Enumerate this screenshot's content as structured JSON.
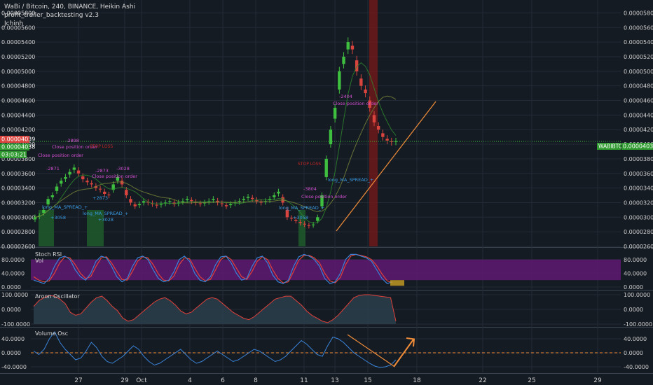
{
  "header": {
    "title": "WaBi / Bitcoin, 240, BINANCE, Heikin Ashi",
    "study": "profit_trailer_backtesting v2.3",
    "author": "Jchinh"
  },
  "price_badges": {
    "last_red": "0.00004039",
    "last_green": "0.00004038",
    "countdown": "03:03:21",
    "symbol_label": "WABIBTC",
    "symbol_value": "0.00004038"
  },
  "annotations": {
    "close_position": "Close position order",
    "long_spread": "long_MA_SPREAD_+",
    "stop_loss": "STOP LOSS",
    "labels": [
      "-2898",
      "-2871",
      "-2873",
      "-3028",
      "+2873",
      "+3028",
      "+3058",
      "-3804",
      "+3058",
      "-2404"
    ]
  },
  "colors": {
    "background": "#151b23",
    "grid": "#232b36",
    "candle_up": "#3fbf3f",
    "candle_down": "#d9443e",
    "purple_band": "#5a1a6e",
    "stoch_k": "#3a83d8",
    "stoch_d": "#e0413a",
    "aroon_fill": "#2a3d4a",
    "aroon_line": "#e0413a",
    "volosc_line": "#3a83d8",
    "trend_orange": "#f08d3a",
    "magenta_text": "#d050d0",
    "blue_text": "#3a9ae0"
  },
  "chart_data": [
    {
      "type": "candlestick",
      "title": "WaBi / Bitcoin, 240, BINANCE, Heikin Ashi",
      "y_ticks": [
        "0.00005800",
        "0.00005600",
        "0.00005400",
        "0.00005200",
        "0.00005000",
        "0.00004800",
        "0.00004600",
        "0.00004400",
        "0.00004200",
        "0.00004000",
        "0.00003800",
        "0.00003600",
        "0.00003400",
        "0.00003200",
        "0.00003000",
        "0.00002800",
        "0.00002600"
      ],
      "ylim": [
        2.6e-05,
        5.9e-05
      ],
      "x_ticks": [
        "27",
        "29",
        "Oct",
        "4",
        "6",
        "8",
        "11",
        "13",
        "15",
        "18",
        "22",
        "25",
        "29"
      ],
      "close": [
        3e-05,
        3.02e-05,
        3.1e-05,
        3.25e-05,
        3.3e-05,
        3.42e-05,
        3.5e-05,
        3.55e-05,
        3.62e-05,
        3.68e-05,
        3.6e-05,
        3.52e-05,
        3.48e-05,
        3.45e-05,
        3.4e-05,
        3.38e-05,
        3.32e-05,
        3.3e-05,
        3.45e-05,
        3.55e-05,
        3.45e-05,
        3.3e-05,
        3.2e-05,
        3.15e-05,
        3.18e-05,
        3.22e-05,
        3.2e-05,
        3.18e-05,
        3.16e-05,
        3.18e-05,
        3.2e-05,
        3.22e-05,
        3.18e-05,
        3.2e-05,
        3.22e-05,
        3.25e-05,
        3.22e-05,
        3.2e-05,
        3.18e-05,
        3.2e-05,
        3.22e-05,
        3.25e-05,
        3.2e-05,
        3.18e-05,
        3.15e-05,
        3.18e-05,
        3.2e-05,
        3.22e-05,
        3.25e-05,
        3.28e-05,
        3.25e-05,
        3.22e-05,
        3.2e-05,
        3.22e-05,
        3.25e-05,
        3.3e-05,
        3.35e-05,
        3.2e-05,
        3e-05,
        2.98e-05,
        2.95e-05,
        2.92e-05,
        2.9e-05,
        2.88e-05,
        2.9e-05,
        3e-05,
        3.3e-05,
        3.8e-05,
        4.2e-05,
        4.5e-05,
        5e-05,
        5.2e-05,
        5.4e-05,
        5.3e-05,
        5e-05,
        4.8e-05,
        4.7e-05,
        4.5e-05,
        4.3e-05,
        4.2e-05,
        4.1e-05,
        4.05e-05,
        4.03e-05,
        4.04e-05
      ]
    },
    {
      "type": "line",
      "title": "Stoch RSI",
      "legend": [
        "Vol"
      ],
      "y_ticks": [
        "80.0000",
        "40.0000",
        "0.0000"
      ],
      "ylim": [
        0,
        100
      ],
      "k": [
        20,
        15,
        10,
        25,
        60,
        85,
        90,
        80,
        50,
        30,
        20,
        40,
        75,
        90,
        85,
        60,
        30,
        15,
        25,
        60,
        85,
        90,
        80,
        50,
        25,
        15,
        20,
        45,
        80,
        90,
        75,
        40,
        20,
        15,
        30,
        65,
        88,
        90,
        70,
        40,
        20,
        25,
        60,
        85,
        90,
        70,
        35,
        15,
        10,
        20,
        60,
        88,
        95,
        90,
        80,
        60,
        25,
        10,
        15,
        40,
        80,
        95,
        95,
        90,
        85,
        75,
        50,
        25,
        10,
        15
      ],
      "d": [
        30,
        20,
        15,
        18,
        40,
        70,
        88,
        85,
        65,
        40,
        25,
        30,
        60,
        85,
        88,
        70,
        45,
        22,
        20,
        45,
        75,
        88,
        85,
        65,
        38,
        20,
        18,
        32,
        65,
        85,
        82,
        55,
        30,
        18,
        22,
        50,
        80,
        90,
        80,
        55,
        30,
        22,
        45,
        75,
        88,
        80,
        50,
        25,
        12,
        15,
        45,
        78,
        92,
        92,
        85,
        70,
        40,
        18,
        12,
        28,
        65,
        90,
        95,
        92,
        88,
        80,
        62,
        38,
        18,
        12
      ]
    },
    {
      "type": "area",
      "title": "Aroon Oscillator",
      "y_ticks": [
        "100.0000",
        "0.0000",
        "-100.0000"
      ],
      "ylim": [
        -100,
        100
      ],
      "values": [
        20,
        60,
        80,
        95,
        90,
        70,
        40,
        -20,
        -40,
        -30,
        10,
        50,
        80,
        90,
        60,
        20,
        -10,
        -60,
        -80,
        -70,
        -40,
        -10,
        20,
        50,
        70,
        80,
        60,
        30,
        -10,
        -30,
        -20,
        10,
        40,
        70,
        80,
        70,
        40,
        10,
        -20,
        -40,
        -60,
        -70,
        -50,
        -20,
        10,
        40,
        70,
        80,
        90,
        90,
        60,
        30,
        -10,
        -40,
        -60,
        -80,
        -90,
        -70,
        -40,
        0,
        40,
        80,
        95,
        100,
        100,
        95,
        90,
        85,
        80,
        -80
      ]
    },
    {
      "type": "line",
      "title": "Volume Osc",
      "y_ticks": [
        "40.0000",
        "0.0000",
        "-40.0000"
      ],
      "ylim": [
        -50,
        60
      ],
      "values": [
        5,
        -5,
        10,
        40,
        60,
        30,
        10,
        -5,
        -20,
        -15,
        5,
        30,
        15,
        -10,
        -25,
        -30,
        -20,
        -10,
        5,
        20,
        10,
        -10,
        -25,
        -35,
        -30,
        -20,
        -10,
        0,
        10,
        -5,
        -20,
        -30,
        -25,
        -15,
        -5,
        5,
        -5,
        -15,
        -25,
        -20,
        -10,
        0,
        10,
        5,
        -5,
        -15,
        -25,
        -20,
        -10,
        5,
        20,
        35,
        25,
        10,
        -5,
        -10,
        20,
        45,
        40,
        30,
        15,
        0,
        -10,
        -20,
        -30,
        -38,
        -42,
        -40,
        -35,
        -20
      ]
    }
  ]
}
